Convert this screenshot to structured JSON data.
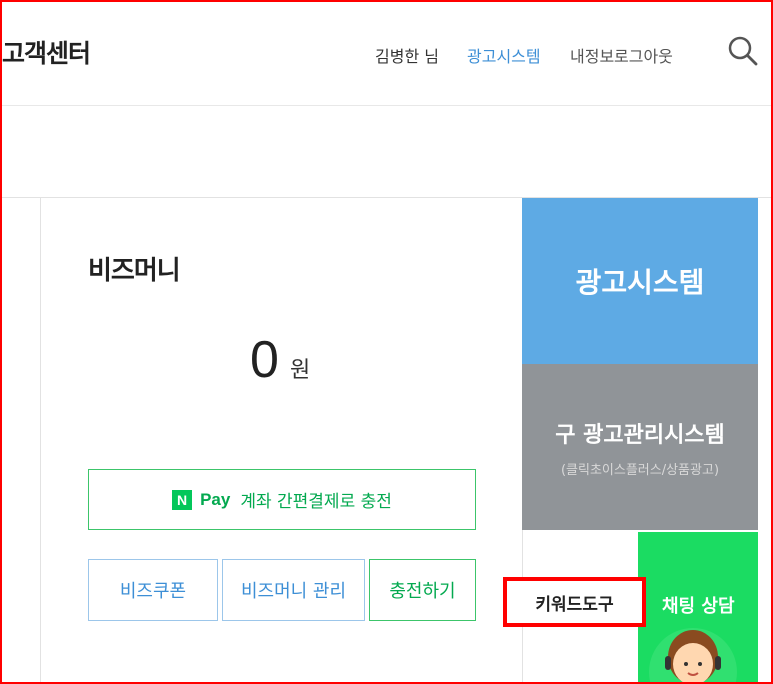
{
  "header": {
    "title": "고객센터",
    "nav": {
      "user": "김병한 님",
      "ad_system": "광고시스템",
      "my_info": "내정보",
      "logout": "로그아웃"
    },
    "search_icon": "search-icon"
  },
  "bizmoney": {
    "title": "비즈머니",
    "amount": "0",
    "unit": "원",
    "npay": {
      "badge": "N",
      "brand": "Pay",
      "label": "계좌 간편결제로 충전"
    },
    "buttons": {
      "coupon": "비즈쿠폰",
      "manage": "비즈머니 관리",
      "charge": "충전하기"
    }
  },
  "tiles": {
    "ad_system": "광고시스템",
    "old_system": "구 광고관리시스템",
    "old_system_sub": "(클릭초이스플러스/상품광고)",
    "keyword_tool": "키워드도구",
    "chat": "채팅 상담"
  },
  "colors": {
    "accent_blue": "#5eaae4",
    "link_blue": "#3d8fd6",
    "naver_green": "#03c75a",
    "chat_green": "#1bdc62",
    "grey_tile": "#909498",
    "highlight_red": "#ff0000"
  }
}
